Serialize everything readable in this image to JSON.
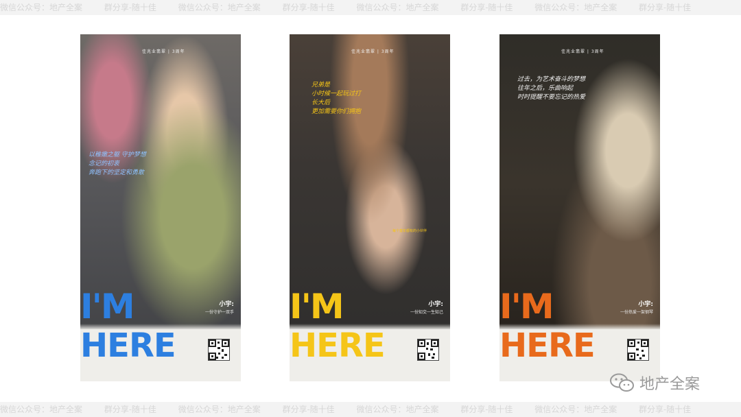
{
  "watermark": {
    "items": [
      "微信公众号：地产全案",
      "群分享-随十佳",
      "微信公众号：地产全案",
      "群分享-随十佳",
      "微信公众号：地产全案",
      "群分享-随十佳",
      "微信公众号：地产全案",
      "群分享-随十佳"
    ]
  },
  "posters": [
    {
      "logo": "佳兆业翡翠 | 3周年",
      "caption": "以稚嫩之躯 守护梦想\n念记的初衷\n奔跑下的坚定和勇敢",
      "headline_1": "I'M",
      "headline_2": "HERE",
      "name": "小宇:",
      "slogan": "一份守护一双手",
      "accent": "#2d7fe0"
    },
    {
      "logo": "佳兆业翡翠 | 3周年",
      "caption": "兄弟是\n小时候一起玩过打\n长大后\n更加需要你们拥抱",
      "note": "每个童年都有的小伙伴",
      "headline_1": "I'M",
      "headline_2": "HERE",
      "name": "小宇:",
      "slogan": "一份知交一生知己",
      "accent": "#f5c518"
    },
    {
      "logo": "佳兆业翡翠 | 3周年",
      "caption": "过去，为艺术奋斗的梦想\n往年之后，乐曲响起\n时时提醒不要忘记的热爱",
      "headline_1": "I'M",
      "headline_2": "HERE",
      "name": "小宇:",
      "slogan": "一份热爱一架钢琴",
      "accent": "#e86a1c"
    }
  ],
  "brand": {
    "name": "地产全案",
    "icon": "wechat-icon",
    "color": "#9a9a9a"
  }
}
